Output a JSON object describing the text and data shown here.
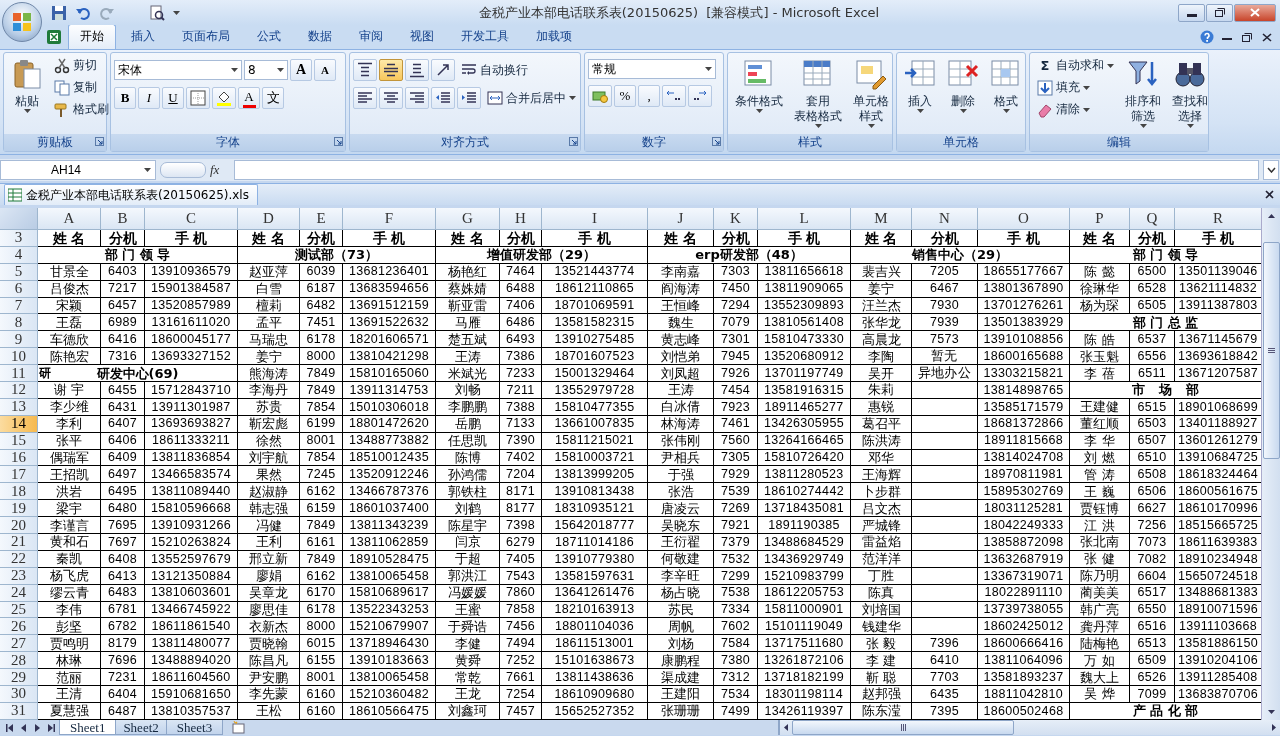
{
  "app": {
    "title": "金税产业本部电话联系表(20150625)  [兼容模式] - Microsoft Excel"
  },
  "ribbon_tabs": [
    {
      "label": "开始",
      "selected": true
    },
    {
      "label": "插入",
      "selected": false
    },
    {
      "label": "页面布局",
      "selected": false
    },
    {
      "label": "公式",
      "selected": false
    },
    {
      "label": "数据",
      "selected": false
    },
    {
      "label": "审阅",
      "selected": false
    },
    {
      "label": "视图",
      "selected": false
    },
    {
      "label": "开发工具",
      "selected": false
    },
    {
      "label": "加载项",
      "selected": false
    }
  ],
  "ribbon_groups": [
    {
      "label": "剪贴板",
      "launcher": true,
      "items": [
        {
          "kind": "big",
          "lines": [
            "粘贴"
          ],
          "caret": true
        },
        {
          "kind": "stack",
          "entries": [
            {
              "label": "剪切"
            },
            {
              "label": "复制"
            },
            {
              "label": "格式刷"
            }
          ]
        }
      ]
    },
    {
      "label": "字体",
      "launcher": true,
      "items": [
        {
          "kind": "tools",
          "upper": [
            {
              "kind": "combo",
              "value": "宋体"
            },
            {
              "kind": "combo",
              "value": "8"
            },
            {
              "kind": "text",
              "label": "A"
            },
            {
              "kind": "text",
              "label": "A"
            }
          ],
          "lower": [
            {
              "kind": "text",
              "label": "B"
            },
            {
              "kind": "text",
              "label": "I"
            },
            {
              "kind": "text",
              "label": "U"
            },
            {
              "kind": "icon"
            },
            {
              "kind": "icon"
            },
            {
              "kind": "fontcolor",
              "label": "A"
            },
            {
              "kind": "text",
              "label": "文"
            }
          ]
        }
      ]
    },
    {
      "label": "对齐方式",
      "launcher": true,
      "items": [
        {
          "kind": "tools",
          "upper": [
            {
              "kind": "icon",
              "selected": false
            },
            {
              "kind": "icon",
              "selected": true
            },
            {
              "kind": "icon",
              "selected": false
            },
            {
              "kind": "icon"
            },
            {
              "kind": "small",
              "label": "自动换行"
            }
          ],
          "lower": [
            {
              "kind": "icon",
              "selected": false
            },
            {
              "kind": "icon",
              "selected": false
            },
            {
              "kind": "icon",
              "selected": false
            },
            {
              "kind": "icon"
            },
            {
              "kind": "icon"
            },
            {
              "kind": "small",
              "label": "合并后居中",
              "caret": true
            }
          ]
        }
      ]
    },
    {
      "label": "数字",
      "launcher": true,
      "items": [
        {
          "kind": "tools",
          "upper": [
            {
              "kind": "combo",
              "value": "常规"
            }
          ],
          "lower": [
            {
              "kind": "icon"
            },
            {
              "kind": "text",
              "label": "%"
            },
            {
              "kind": "text",
              "label": ","
            },
            {
              "kind": "icon"
            },
            {
              "kind": "icon"
            }
          ]
        }
      ]
    },
    {
      "label": "样式",
      "items": [
        {
          "kind": "big",
          "lines": [
            "条件格式"
          ],
          "caret": true
        },
        {
          "kind": "big",
          "lines": [
            "套用",
            "表格格式"
          ],
          "caret": true
        },
        {
          "kind": "big",
          "lines": [
            "单元格",
            "样式"
          ],
          "caret": true
        }
      ]
    },
    {
      "label": "单元格",
      "items": [
        {
          "kind": "big",
          "lines": [
            "插入"
          ],
          "caret": true
        },
        {
          "kind": "big",
          "lines": [
            "删除"
          ],
          "caret": true
        },
        {
          "kind": "big",
          "lines": [
            "格式"
          ],
          "caret": true
        }
      ]
    },
    {
      "label": "编辑",
      "items": [
        {
          "kind": "stack",
          "entries": [
            {
              "label": "自动求和",
              "glyph": "Σ",
              "caret": true
            },
            {
              "label": "填充",
              "caret": true
            },
            {
              "label": "清除",
              "caret": true
            }
          ]
        },
        {
          "kind": "big",
          "lines": [
            "排序和",
            "筛选"
          ],
          "caret": true
        },
        {
          "kind": "big",
          "lines": [
            "查找和",
            "选择"
          ],
          "caret": true
        }
      ]
    }
  ],
  "name_box": "AH14",
  "formula_label": "fx",
  "workbook": {
    "title": "金税产业本部电话联系表(20150625).xls"
  },
  "columns": [
    "A",
    "B",
    "C",
    "D",
    "E",
    "F",
    "G",
    "H",
    "I",
    "J",
    "K",
    "L",
    "M",
    "N",
    "O",
    "P",
    "Q",
    "R"
  ],
  "rows": [
    {
      "num": "3",
      "selected": false,
      "groups": [
        {
          "kind": "heading",
          "name": "姓 名",
          "ext": "分机",
          "mobile": "手 机"
        },
        {
          "kind": "heading",
          "name": "姓 名",
          "ext": "分机",
          "mobile": "手 机"
        },
        {
          "kind": "heading",
          "name": "姓 名",
          "ext": "分机",
          "mobile": "手 机"
        },
        {
          "kind": "heading",
          "name": "姓 名",
          "ext": "分机",
          "mobile": "手 机"
        },
        {
          "kind": "heading",
          "name": "姓 名",
          "ext": "分机",
          "mobile": "手 机"
        },
        {
          "kind": "heading",
          "name": "姓 名",
          "ext": "分机",
          "mobile": "手 机"
        }
      ]
    },
    {
      "num": "4",
      "selected": false,
      "groups": [
        {
          "kind": "section",
          "title": "部 门 领 导"
        },
        {
          "kind": "section",
          "title": "测试部（73）"
        },
        {
          "kind": "section",
          "title": "增值研发部（29）"
        },
        {
          "kind": "section",
          "title": "erp研发部（48）"
        },
        {
          "kind": "section",
          "title": "销售中心（29）"
        },
        {
          "kind": "section",
          "title": "部 门 领 导"
        }
      ]
    },
    {
      "num": "5",
      "selected": false,
      "groups": [
        {
          "kind": "person",
          "name": "甘景全",
          "ext": "6403",
          "mobile": "13910936579"
        },
        {
          "kind": "person",
          "name": "赵亚萍",
          "ext": "6039",
          "mobile": "13681236401"
        },
        {
          "kind": "person",
          "name": "杨艳红",
          "ext": "7464",
          "mobile": "13521443774"
        },
        {
          "kind": "person",
          "name": "李南嘉",
          "ext": "7303",
          "mobile": "13811656618"
        },
        {
          "kind": "person",
          "name": "裴吉兴",
          "ext": "7205",
          "mobile": "18655177667"
        },
        {
          "kind": "person",
          "name": "陈 懿",
          "ext": "6500",
          "mobile": "13501139046"
        }
      ]
    },
    {
      "num": "6",
      "selected": false,
      "groups": [
        {
          "kind": "person",
          "name": "吕俊杰",
          "ext": "7217",
          "mobile": "15901384587"
        },
        {
          "kind": "person",
          "name": "白雪",
          "ext": "6187",
          "mobile": "13683594656"
        },
        {
          "kind": "person",
          "name": "蔡姝婧",
          "ext": "6488",
          "mobile": "18612110865"
        },
        {
          "kind": "person",
          "name": "阎海涛",
          "ext": "7450",
          "mobile": "13811909065"
        },
        {
          "kind": "person",
          "name": "姜宁",
          "ext": "6467",
          "mobile": "13801367890"
        },
        {
          "kind": "person",
          "name": "徐琳华",
          "ext": "6528",
          "mobile": "13621114832"
        }
      ]
    },
    {
      "num": "7",
      "selected": false,
      "groups": [
        {
          "kind": "person",
          "name": "宋颖",
          "ext": "6457",
          "mobile": "13520857989"
        },
        {
          "kind": "person",
          "name": "檀莉",
          "ext": "6482",
          "mobile": "13691512159"
        },
        {
          "kind": "person",
          "name": "靳亚雷",
          "ext": "7406",
          "mobile": "18701069591"
        },
        {
          "kind": "person",
          "name": "王恒峰",
          "ext": "7294",
          "mobile": "13552309893"
        },
        {
          "kind": "person",
          "name": "汪兰杰",
          "ext": "7930",
          "mobile": "13701276261"
        },
        {
          "kind": "person",
          "name": "杨为琛",
          "ext": "6505",
          "mobile": "13911387803"
        }
      ]
    },
    {
      "num": "8",
      "selected": false,
      "groups": [
        {
          "kind": "person",
          "name": "王磊",
          "ext": "6989",
          "mobile": "13161611020"
        },
        {
          "kind": "person",
          "name": "孟平",
          "ext": "7451",
          "mobile": "13691522632"
        },
        {
          "kind": "person",
          "name": "马雁",
          "ext": "6486",
          "mobile": "13581582315"
        },
        {
          "kind": "person",
          "name": "魏生",
          "ext": "7079",
          "mobile": "13810561408"
        },
        {
          "kind": "person",
          "name": "张华龙",
          "ext": "7939",
          "mobile": "13501383929"
        },
        {
          "kind": "section",
          "title": "部 门 总 监"
        }
      ]
    },
    {
      "num": "9",
      "selected": false,
      "groups": [
        {
          "kind": "person",
          "name": "车德欣",
          "ext": "6416",
          "mobile": "18600045177"
        },
        {
          "kind": "person",
          "name": "马瑞忠",
          "ext": "6178",
          "mobile": "18201606571"
        },
        {
          "kind": "person",
          "name": "楚五斌",
          "ext": "6493",
          "mobile": "13910275485"
        },
        {
          "kind": "person",
          "name": "黄志峰",
          "ext": "7301",
          "mobile": "15810473330"
        },
        {
          "kind": "person",
          "name": "高晨龙",
          "ext": "7573",
          "mobile": "13910108856"
        },
        {
          "kind": "person",
          "name": "陈 皓",
          "ext": "6537",
          "mobile": "13671145679"
        }
      ]
    },
    {
      "num": "10",
      "selected": false,
      "groups": [
        {
          "kind": "person",
          "name": "陈艳宏",
          "ext": "7316",
          "mobile": "13693327152"
        },
        {
          "kind": "person",
          "name": "姜宁",
          "ext": "8000",
          "mobile": "13810421298"
        },
        {
          "kind": "person",
          "name": "王涛",
          "ext": "7386",
          "mobile": "18701607523"
        },
        {
          "kind": "person",
          "name": "刘恺弟",
          "ext": "7945",
          "mobile": "13520680912"
        },
        {
          "kind": "person",
          "name": "李陶",
          "ext": "暂无",
          "mobile": "18600165688"
        },
        {
          "kind": "person",
          "name": "张玉魁",
          "ext": "6556",
          "mobile": "13693618842"
        }
      ]
    },
    {
      "num": "11",
      "selected": false,
      "groups": [
        {
          "kind": "section",
          "title": "研发中心(69)",
          "spill": "研"
        },
        {
          "kind": "person",
          "name": "熊海涛",
          "ext": "7849",
          "mobile": "15810165060"
        },
        {
          "kind": "person",
          "name": "米斌光",
          "ext": "7233",
          "mobile": "15001329464"
        },
        {
          "kind": "person",
          "name": "刘凤超",
          "ext": "7926",
          "mobile": "13701197749"
        },
        {
          "kind": "person",
          "name": "吴开",
          "ext": "异地办公",
          "mobile": "13303215821"
        },
        {
          "kind": "person",
          "name": "李 蓓",
          "ext": "6511",
          "mobile": "13671207587"
        }
      ]
    },
    {
      "num": "12",
      "selected": false,
      "groups": [
        {
          "kind": "person",
          "name": "谢 宇",
          "ext": "6455",
          "mobile": "15712843710"
        },
        {
          "kind": "person",
          "name": "李海丹",
          "ext": "7849",
          "mobile": "13911314753"
        },
        {
          "kind": "person",
          "name": "刘畅",
          "ext": "7211",
          "mobile": "13552979728"
        },
        {
          "kind": "person",
          "name": "王涛",
          "ext": "7454",
          "mobile": "13581916315"
        },
        {
          "kind": "person",
          "name": "朱莉",
          "mobile": "13814898765"
        },
        {
          "kind": "section",
          "title": "市   场   部"
        }
      ]
    },
    {
      "num": "13",
      "selected": false,
      "groups": [
        {
          "kind": "person",
          "name": "李少维",
          "ext": "6431",
          "mobile": "13911301987"
        },
        {
          "kind": "person",
          "name": "苏贵",
          "ext": "7854",
          "mobile": "15010306018"
        },
        {
          "kind": "person",
          "name": "李鹏鹏",
          "ext": "7388",
          "mobile": "15810477355"
        },
        {
          "kind": "person",
          "name": "白冰倩",
          "ext": "7923",
          "mobile": "18911465277"
        },
        {
          "kind": "person",
          "name": "惠锐",
          "mobile": "13585171579"
        },
        {
          "kind": "person",
          "name": "王建健",
          "ext": "6515",
          "mobile": "18901068699"
        }
      ]
    },
    {
      "num": "14",
      "selected": true,
      "groups": [
        {
          "kind": "person",
          "name": "李利",
          "ext": "6407",
          "mobile": "13693693827"
        },
        {
          "kind": "person",
          "name": "靳宏彪",
          "ext": "6199",
          "mobile": "18801472620"
        },
        {
          "kind": "person",
          "name": "岳鹏",
          "ext": "7133",
          "mobile": "13661007835"
        },
        {
          "kind": "person",
          "name": "林海涛",
          "ext": "7461",
          "mobile": "13426305955"
        },
        {
          "kind": "person",
          "name": "葛召平",
          "mobile": "18681372866"
        },
        {
          "kind": "person",
          "name": "董红顺",
          "ext": "6503",
          "mobile": "13401188927"
        }
      ]
    },
    {
      "num": "15",
      "selected": false,
      "groups": [
        {
          "kind": "person",
          "name": "张平",
          "ext": "6406",
          "mobile": "18611333211"
        },
        {
          "kind": "person",
          "name": "徐然",
          "ext": "8001",
          "mobile": "13488773882"
        },
        {
          "kind": "person",
          "name": "任思凯",
          "ext": "7390",
          "mobile": "15811215021"
        },
        {
          "kind": "person",
          "name": "张伟刚",
          "ext": "7560",
          "mobile": "13264166465"
        },
        {
          "kind": "person",
          "name": "陈洪涛",
          "mobile": "18911815668"
        },
        {
          "kind": "person",
          "name": "李 华",
          "ext": "6507",
          "mobile": "13601261279"
        }
      ]
    },
    {
      "num": "16",
      "selected": false,
      "groups": [
        {
          "kind": "person",
          "name": "偶瑞军",
          "ext": "6409",
          "mobile": "13811836854"
        },
        {
          "kind": "person",
          "name": "刘宇航",
          "ext": "7854",
          "mobile": "18510012435"
        },
        {
          "kind": "person",
          "name": "陈博",
          "ext": "7402",
          "mobile": "15810003721"
        },
        {
          "kind": "person",
          "name": "尹相兵",
          "ext": "7305",
          "mobile": "15810726420"
        },
        {
          "kind": "person",
          "name": "邓华",
          "mobile": "13814024708"
        },
        {
          "kind": "person",
          "name": "刘 燃",
          "ext": "6510",
          "mobile": "13910684725"
        }
      ]
    },
    {
      "num": "17",
      "selected": false,
      "groups": [
        {
          "kind": "person",
          "name": "王招凯",
          "ext": "6497",
          "mobile": "13466583574"
        },
        {
          "kind": "person",
          "name": "果然",
          "ext": "7245",
          "mobile": "13520912246"
        },
        {
          "kind": "person",
          "name": "孙鸿儒",
          "ext": "7204",
          "mobile": "13813999205"
        },
        {
          "kind": "person",
          "name": "于强",
          "ext": "7929",
          "mobile": "13811280523"
        },
        {
          "kind": "person",
          "name": "王海辉",
          "mobile": "18970811981"
        },
        {
          "kind": "person",
          "name": "管 涛",
          "ext": "6508",
          "mobile": "18618324464"
        }
      ]
    },
    {
      "num": "18",
      "selected": false,
      "groups": [
        {
          "kind": "person",
          "name": "洪岩",
          "ext": "6495",
          "mobile": "13811089440"
        },
        {
          "kind": "person",
          "name": "赵淑静",
          "ext": "6162",
          "mobile": "13466787376"
        },
        {
          "kind": "person",
          "name": "郭铁柱",
          "ext": "8171",
          "mobile": "13910813438"
        },
        {
          "kind": "person",
          "name": "张浩",
          "ext": "7539",
          "mobile": "18610274442"
        },
        {
          "kind": "person",
          "name": "卜步群",
          "mobile": "15895302769"
        },
        {
          "kind": "person",
          "name": "王 巍",
          "ext": "6506",
          "mobile": "18600561675"
        }
      ]
    },
    {
      "num": "19",
      "selected": false,
      "groups": [
        {
          "kind": "person",
          "name": "梁宇",
          "ext": "6480",
          "mobile": "15810596668"
        },
        {
          "kind": "person",
          "name": "韩志强",
          "ext": "6159",
          "mobile": "18601037400"
        },
        {
          "kind": "person",
          "name": "刘鹤",
          "ext": "8177",
          "mobile": "18310935121"
        },
        {
          "kind": "person",
          "name": "唐凌云",
          "ext": "7269",
          "mobile": "13718435081"
        },
        {
          "kind": "person",
          "name": "吕文杰",
          "mobile": "18031125281"
        },
        {
          "kind": "person",
          "name": "贾钰博",
          "ext": "6627",
          "mobile": "18610170996"
        }
      ]
    },
    {
      "num": "20",
      "selected": false,
      "groups": [
        {
          "kind": "person",
          "name": "李谨言",
          "ext": "7695",
          "mobile": "13910931266"
        },
        {
          "kind": "person",
          "name": "冯健",
          "ext": "7849",
          "mobile": "13811343239"
        },
        {
          "kind": "person",
          "name": "陈星宇",
          "ext": "7398",
          "mobile": "15642018777"
        },
        {
          "kind": "person",
          "name": "吴晓东",
          "ext": "7921",
          "mobile": "1891190385"
        },
        {
          "kind": "person",
          "name": "严城锋",
          "mobile": "18042249333"
        },
        {
          "kind": "person",
          "name": "江 洪",
          "ext": "7256",
          "mobile": "18515665725"
        }
      ]
    },
    {
      "num": "21",
      "selected": false,
      "groups": [
        {
          "kind": "person",
          "name": "黄和石",
          "ext": "7697",
          "mobile": "15210263824"
        },
        {
          "kind": "person",
          "name": "王利",
          "ext": "6161",
          "mobile": "13811062859"
        },
        {
          "kind": "person",
          "name": "闫京",
          "ext": "6279",
          "mobile": "18711014186"
        },
        {
          "kind": "person",
          "name": "王衍翟",
          "ext": "7379",
          "mobile": "13488684529"
        },
        {
          "kind": "person",
          "name": "雷益焰",
          "mobile": "13858872098"
        },
        {
          "kind": "person",
          "name": "张北南",
          "ext": "7073",
          "mobile": "18611639383"
        }
      ]
    },
    {
      "num": "22",
      "selected": false,
      "groups": [
        {
          "kind": "person",
          "name": "秦凯",
          "ext": "6408",
          "mobile": "13552597679"
        },
        {
          "kind": "person",
          "name": "邢立新",
          "ext": "7849",
          "mobile": "18910528475"
        },
        {
          "kind": "person",
          "name": "于超",
          "ext": "7405",
          "mobile": "13910779380"
        },
        {
          "kind": "person",
          "name": "何敬建",
          "ext": "7532",
          "mobile": "13436929749"
        },
        {
          "kind": "person",
          "name": "范洋洋",
          "mobile": "13632687919"
        },
        {
          "kind": "person",
          "name": "张 健",
          "ext": "7082",
          "mobile": "18910234948"
        }
      ]
    },
    {
      "num": "23",
      "selected": false,
      "groups": [
        {
          "kind": "person",
          "name": "杨飞虎",
          "ext": "6413",
          "mobile": "13121350884"
        },
        {
          "kind": "person",
          "name": "廖娟",
          "ext": "6162",
          "mobile": "13810065458"
        },
        {
          "kind": "person",
          "name": "郭洪江",
          "ext": "7543",
          "mobile": "13581597631"
        },
        {
          "kind": "person",
          "name": "李辛旺",
          "ext": "7299",
          "mobile": "15210983799"
        },
        {
          "kind": "person",
          "name": "丁胜",
          "mobile": "13367319071"
        },
        {
          "kind": "person",
          "name": "陈乃明",
          "ext": "6604",
          "mobile": "15650724518"
        }
      ]
    },
    {
      "num": "24",
      "selected": false,
      "groups": [
        {
          "kind": "person",
          "name": "缪云青",
          "ext": "6483",
          "mobile": "13810603601"
        },
        {
          "kind": "person",
          "name": "吴章龙",
          "ext": "6170",
          "mobile": "15810689617"
        },
        {
          "kind": "person",
          "name": "冯媛媛",
          "ext": "7860",
          "mobile": "13641261476"
        },
        {
          "kind": "person",
          "name": "杨占晓",
          "ext": "7538",
          "mobile": "18612205753"
        },
        {
          "kind": "person",
          "name": "陈真",
          "mobile": "18022891110"
        },
        {
          "kind": "person",
          "name": "蔺美美",
          "ext": "6517",
          "mobile": "13488681383"
        }
      ]
    },
    {
      "num": "25",
      "selected": false,
      "groups": [
        {
          "kind": "person",
          "name": "李伟",
          "ext": "6781",
          "mobile": "13466745922"
        },
        {
          "kind": "person",
          "name": "廖思佳",
          "ext": "6178",
          "mobile": "13522343253"
        },
        {
          "kind": "person",
          "name": "王蜜",
          "ext": "7858",
          "mobile": "18210163913"
        },
        {
          "kind": "person",
          "name": "苏民",
          "ext": "7334",
          "mobile": "15811000901"
        },
        {
          "kind": "person",
          "name": "刘培国",
          "mobile": "13739738055"
        },
        {
          "kind": "person",
          "name": "韩广亮",
          "ext": "6550",
          "mobile": "18910071596"
        }
      ]
    },
    {
      "num": "26",
      "selected": false,
      "groups": [
        {
          "kind": "person",
          "name": "彭坚",
          "ext": "6782",
          "mobile": "18611861540"
        },
        {
          "kind": "person",
          "name": "衣新杰",
          "ext": "8000",
          "mobile": "15210679907"
        },
        {
          "kind": "person",
          "name": "于舜诰",
          "ext": "7456",
          "mobile": "18801104036"
        },
        {
          "kind": "person",
          "name": "周帆",
          "ext": "7602",
          "mobile": "15101119049"
        },
        {
          "kind": "person",
          "name": "钱建华",
          "mobile": "18602425012"
        },
        {
          "kind": "person",
          "name": "龚丹萍",
          "ext": "6516",
          "mobile": "13911103668"
        }
      ]
    },
    {
      "num": "27",
      "selected": false,
      "groups": [
        {
          "kind": "person",
          "name": "贾鸣明",
          "ext": "8179",
          "mobile": "13811480077"
        },
        {
          "kind": "person",
          "name": "贾晓翰",
          "ext": "6015",
          "mobile": "13718946430"
        },
        {
          "kind": "person",
          "name": "李健",
          "ext": "7494",
          "mobile": "18611513001"
        },
        {
          "kind": "person",
          "name": "刘杨",
          "ext": "7584",
          "mobile": "13717511680"
        },
        {
          "kind": "person",
          "name": "张 毅",
          "ext": "7396",
          "mobile": "18600666416"
        },
        {
          "kind": "person",
          "name": "陆梅艳",
          "ext": "6513",
          "mobile": "13581886150"
        }
      ]
    },
    {
      "num": "28",
      "selected": false,
      "groups": [
        {
          "kind": "person",
          "name": "林琳",
          "ext": "7696",
          "mobile": "13488894020"
        },
        {
          "kind": "person",
          "name": "陈昌凡",
          "ext": "6155",
          "mobile": "13910183663"
        },
        {
          "kind": "person",
          "name": "黄舜",
          "ext": "7252",
          "mobile": "15101638673"
        },
        {
          "kind": "person",
          "name": "康鹏程",
          "ext": "7380",
          "mobile": "13261872106"
        },
        {
          "kind": "person",
          "name": "李 建",
          "ext": "6410",
          "mobile": "13811064096"
        },
        {
          "kind": "person",
          "name": "万 如",
          "ext": "6509",
          "mobile": "13910204106"
        }
      ]
    },
    {
      "num": "29",
      "selected": false,
      "groups": [
        {
          "kind": "person",
          "name": "范丽",
          "ext": "7231",
          "mobile": "18611604560"
        },
        {
          "kind": "person",
          "name": "尹安鹏",
          "ext": "8001",
          "mobile": "13810065458"
        },
        {
          "kind": "person",
          "name": "常乾",
          "ext": "7661",
          "mobile": "13811438636"
        },
        {
          "kind": "person",
          "name": "渠成建",
          "ext": "7312",
          "mobile": "13718182199"
        },
        {
          "kind": "person",
          "name": "靳 聪",
          "ext": "7703",
          "mobile": "13581893237"
        },
        {
          "kind": "person",
          "name": "魏大上",
          "ext": "6526",
          "mobile": "13911285408"
        }
      ]
    },
    {
      "num": "30",
      "selected": false,
      "groups": [
        {
          "kind": "person",
          "name": "王清",
          "ext": "6404",
          "mobile": "15910681650"
        },
        {
          "kind": "person",
          "name": "李先蒙",
          "ext": "6160",
          "mobile": "15210360482"
        },
        {
          "kind": "person",
          "name": "王龙",
          "ext": "7254",
          "mobile": "18610909680"
        },
        {
          "kind": "person",
          "name": "王建阳",
          "ext": "7534",
          "mobile": "18301198114"
        },
        {
          "kind": "person",
          "name": "赵邦强",
          "ext": "6435",
          "mobile": "18811042810"
        },
        {
          "kind": "person",
          "name": "吴 烨",
          "ext": "7099",
          "mobile": "13683870706"
        }
      ]
    },
    {
      "num": "31",
      "selected": false,
      "groups": [
        {
          "kind": "person",
          "name": "夏慧强",
          "ext": "6487",
          "mobile": "13810357537"
        },
        {
          "kind": "person",
          "name": "王松",
          "ext": "6160",
          "mobile": "18610566475"
        },
        {
          "kind": "person",
          "name": "刘鑫珂",
          "ext": "7457",
          "mobile": "15652527352"
        },
        {
          "kind": "person",
          "name": "张珊珊",
          "ext": "7499",
          "mobile": "13426119397"
        },
        {
          "kind": "person",
          "name": "陈东滢",
          "ext": "7395",
          "mobile": "18600502468"
        },
        {
          "kind": "section",
          "title": "产 品 化 部"
        }
      ]
    }
  ],
  "sheets": [
    {
      "label": "Sheet1",
      "selected": true
    },
    {
      "label": "Sheet2",
      "selected": false
    },
    {
      "label": "Sheet3",
      "selected": false
    }
  ]
}
